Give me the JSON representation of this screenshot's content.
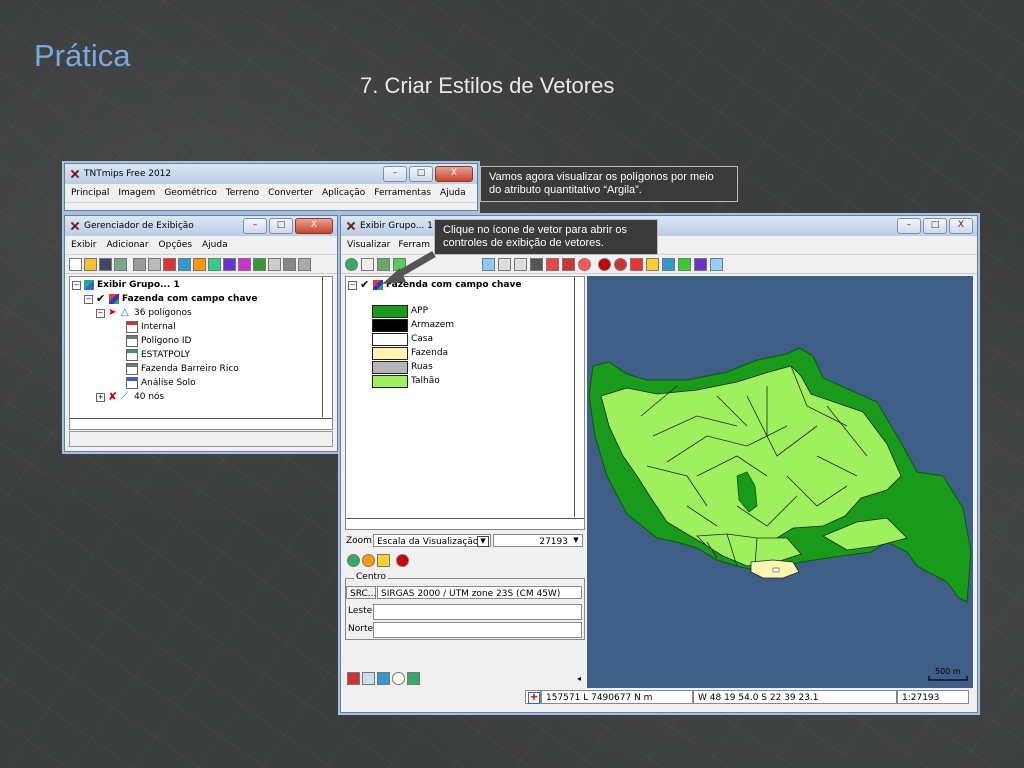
{
  "slide": {
    "title": "Prática",
    "subtitle": "7. Criar Estilos de Vetores"
  },
  "main_window": {
    "title": "TNTmips Free 2012",
    "menu": [
      "Principal",
      "Imagem",
      "Geométrico",
      "Terreno",
      "Converter",
      "Aplicação",
      "Ferramentas",
      "Ajuda"
    ]
  },
  "callout_top": "Vamos agora visualizar os polígonos por meio do atributo quantitativo “Argila”.",
  "callout_mid": "Clique no ícone de vetor para abrir os controles de exibição de vetores.",
  "manager": {
    "title": "Gerenciador de Exibição",
    "menu": [
      "Exibir",
      "Adicionar",
      "Opções",
      "Ajuda"
    ],
    "tree": [
      {
        "label": "Exibir Grupo... 1",
        "bold": true
      },
      {
        "label": "Fazenda com campo chave",
        "bold": true
      },
      {
        "label": "36 polígonos"
      },
      {
        "label": "Internal"
      },
      {
        "label": "Polígono ID"
      },
      {
        "label": "ESTATPOLY"
      },
      {
        "label": "Fazenda Barreiro Rico"
      },
      {
        "label": "Análise Solo"
      },
      {
        "label": "40 nós"
      }
    ]
  },
  "view": {
    "title": "Exibir Grupo... 1 -",
    "menu": [
      "Visualizar",
      "Ferram"
    ],
    "layer": "Fazenda com campo chave",
    "legend": [
      {
        "label": "APP",
        "color": "#1a9a1a"
      },
      {
        "label": "Armazem",
        "color": "#000000"
      },
      {
        "label": "Casa",
        "color": "#ffffff"
      },
      {
        "label": "Fazenda",
        "color": "#fef6b0"
      },
      {
        "label": "Ruas",
        "color": "#b4b4b4"
      },
      {
        "label": "Talhão",
        "color": "#9ef05e"
      }
    ],
    "zoom_label": "Zoom",
    "zoom_mode": "Escala da Visualização",
    "zoom_value": "27193",
    "center_label": "Centro",
    "src_label": "SRC...",
    "src_value": "SIRGAS 2000 / UTM zone 23S (CM 45W)",
    "leste_label": "Leste",
    "norte_label": "Norte",
    "scalebar": "500 m",
    "status_coords": "157571 L 7490677 N m",
    "status_geo": "W 48 19 54.0  S 22 39 23.1",
    "status_scale": "1:27193"
  }
}
